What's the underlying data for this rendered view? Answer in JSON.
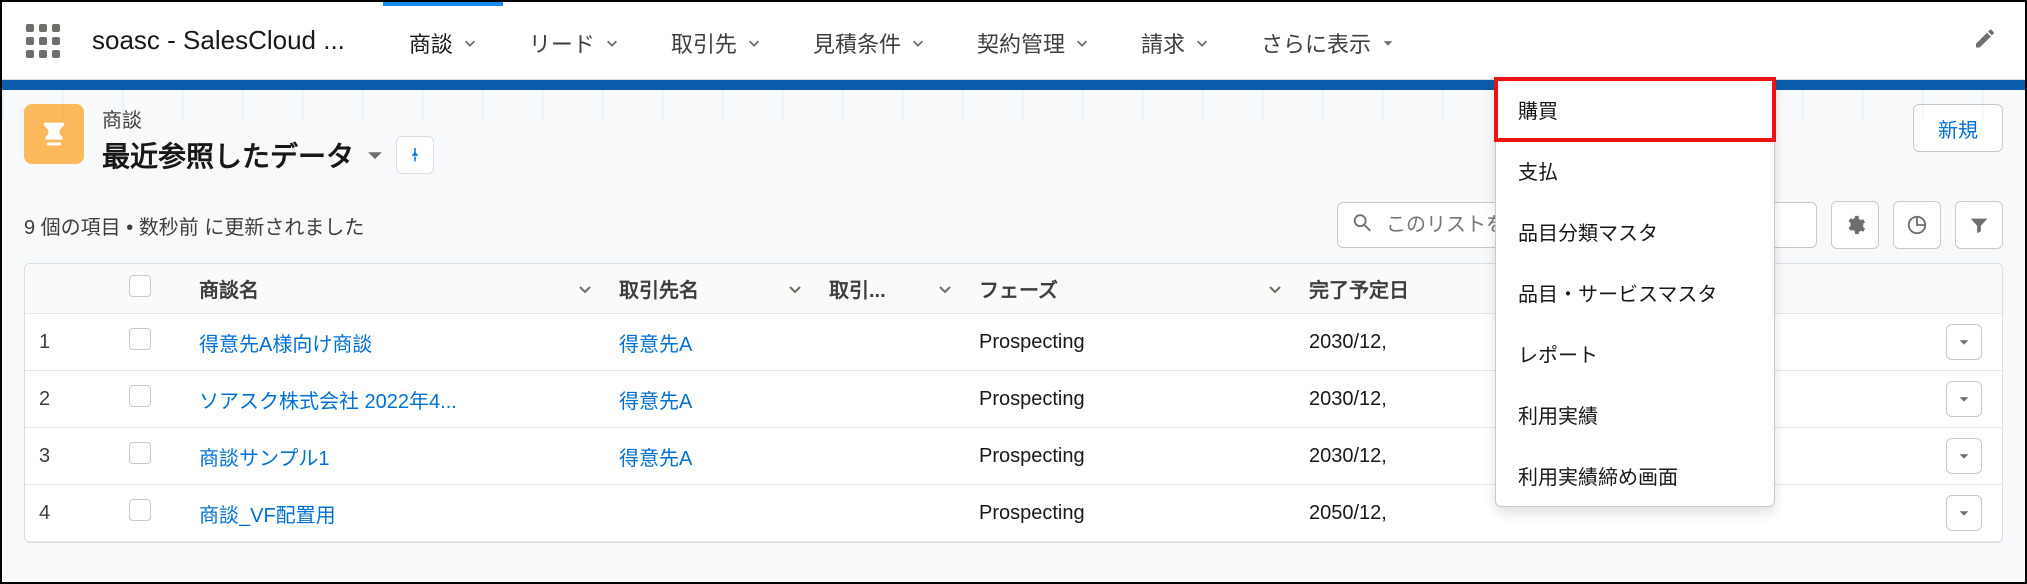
{
  "app": {
    "name": "soasc - SalesCloud ..."
  },
  "nav": {
    "tabs": [
      {
        "label": "商談"
      },
      {
        "label": "リード"
      },
      {
        "label": "取引先"
      },
      {
        "label": "見積条件"
      },
      {
        "label": "契約管理"
      },
      {
        "label": "請求"
      }
    ],
    "more_label": "さらに表示"
  },
  "dropdown": {
    "items": [
      {
        "label": "購買"
      },
      {
        "label": "支払"
      },
      {
        "label": "品目分類マスタ"
      },
      {
        "label": "品目・サービスマスタ"
      },
      {
        "label": "レポート"
      },
      {
        "label": "利用実績"
      },
      {
        "label": "利用実績締め画面"
      }
    ]
  },
  "list": {
    "object_label": "商談",
    "view_name": "最近参照したデータ",
    "meta": "9 個の項目 • 数秒前 に更新されました",
    "search_placeholder": "このリストを検索...",
    "new_label": "新規"
  },
  "table": {
    "headers": {
      "name": "商談名",
      "account": "取引先名",
      "account_trunc": "取引...",
      "phase": "フェーズ",
      "close_date": "完了予定日"
    },
    "rows": [
      {
        "num": "1",
        "name": "得意先A様向け商談",
        "account": "得意先A",
        "phase": "Prospecting",
        "close_date": "2030/12,"
      },
      {
        "num": "2",
        "name": "ソアスク株式会社 2022年4...",
        "account": "得意先A",
        "phase": "Prospecting",
        "close_date": "2030/12,"
      },
      {
        "num": "3",
        "name": "商談サンプル1",
        "account": "得意先A",
        "phase": "Prospecting",
        "close_date": "2030/12,"
      },
      {
        "num": "4",
        "name": "商談_VF配置用",
        "account": "",
        "phase": "Prospecting",
        "close_date": "2050/12,"
      }
    ]
  }
}
